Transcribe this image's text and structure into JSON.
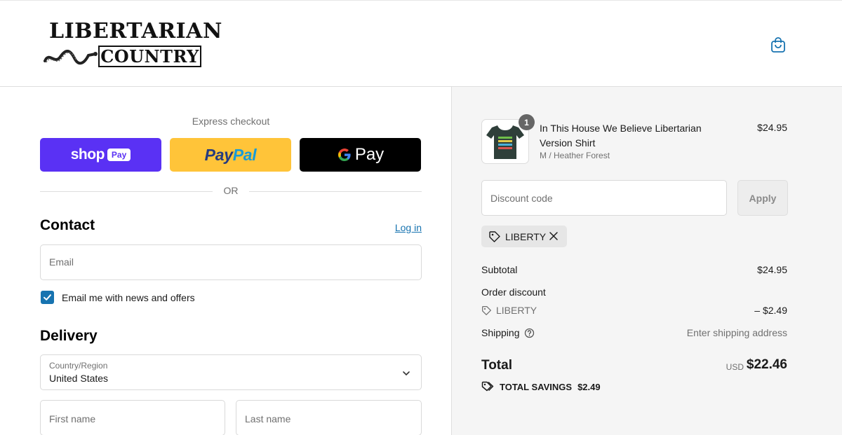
{
  "header": {
    "logo_line1": "LIBERTARIAN",
    "logo_line2": "COUNTRY",
    "cart_icon": "shopping-bag-icon"
  },
  "express": {
    "label": "Express checkout",
    "shop": {
      "text": "shop",
      "badge": "Pay"
    },
    "paypal": {
      "part1": "Pay",
      "part2": "Pal"
    },
    "gpay": {
      "text": "Pay"
    },
    "or_text": "OR"
  },
  "contact": {
    "title": "Contact",
    "login_link": "Log in",
    "email_placeholder": "Email",
    "newsletter_label": "Email me with news and offers",
    "newsletter_checked": true
  },
  "delivery": {
    "title": "Delivery",
    "country_label": "Country/Region",
    "country_value": "United States",
    "first_name_placeholder": "First name",
    "last_name_placeholder": "Last name"
  },
  "summary": {
    "product": {
      "name": "In This House We Believe Libertarian Version Shirt",
      "variant": "M / Heather Forest",
      "price": "$24.95",
      "quantity": "1"
    },
    "discount_placeholder": "Discount code",
    "apply_label": "Apply",
    "applied_code": "LIBERTY",
    "subtotal_label": "Subtotal",
    "subtotal_value": "$24.95",
    "order_discount_label": "Order discount",
    "discount_code_label": "LIBERTY",
    "discount_value": "– $2.49",
    "shipping_label": "Shipping",
    "shipping_value": "Enter shipping address",
    "total_label": "Total",
    "total_currency": "USD",
    "total_value": "$22.46",
    "savings_label": "TOTAL SAVINGS",
    "savings_value": "$2.49"
  },
  "colors": {
    "accent": "#1773b0",
    "shop_pay": "#5a31f4",
    "paypal": "#ffc439",
    "gpay": "#000000",
    "summary_bg": "#f5f5f5"
  }
}
